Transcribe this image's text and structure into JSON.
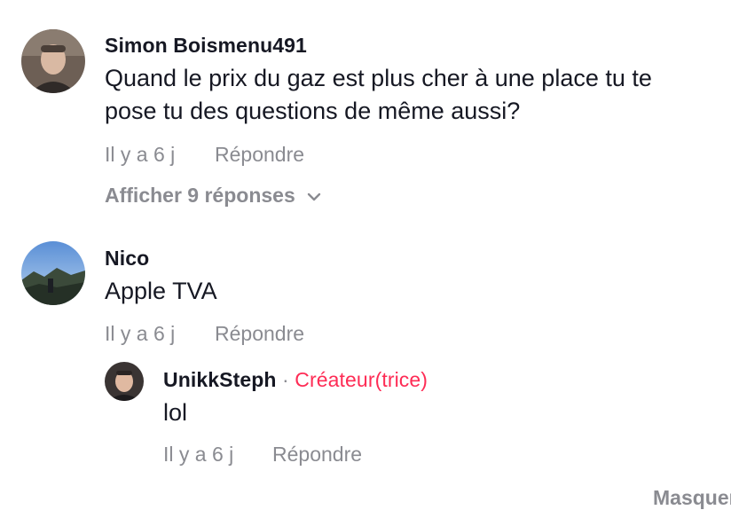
{
  "comments": [
    {
      "username": "Simon Boismenu491",
      "text_line1": "Quand le prix du gaz est plus cher à une place tu te",
      "text_line2": "pose tu des questions de même aussi?",
      "time": "Il y a 6 j",
      "reply_label": "Répondre",
      "view_replies_label": "Afficher 9 réponses",
      "avatar_icon": "user-photo-avatar"
    },
    {
      "username": "Nico",
      "text": "Apple TVA",
      "time": "Il y a 6 j",
      "reply_label": "Répondre",
      "avatar_icon": "landscape-photo-avatar",
      "replies": [
        {
          "username": "UnikkSteph",
          "separator": "·",
          "creator_badge": "Créateur(trice)",
          "text": "lol",
          "time": "Il y a 6 j",
          "reply_label": "Répondre",
          "avatar_icon": "user-photo-avatar"
        }
      ]
    }
  ],
  "footer": {
    "hide_label": "Masquer"
  },
  "colors": {
    "text": "#161823",
    "muted": "#8a8b91",
    "creator": "#fe2c55"
  }
}
